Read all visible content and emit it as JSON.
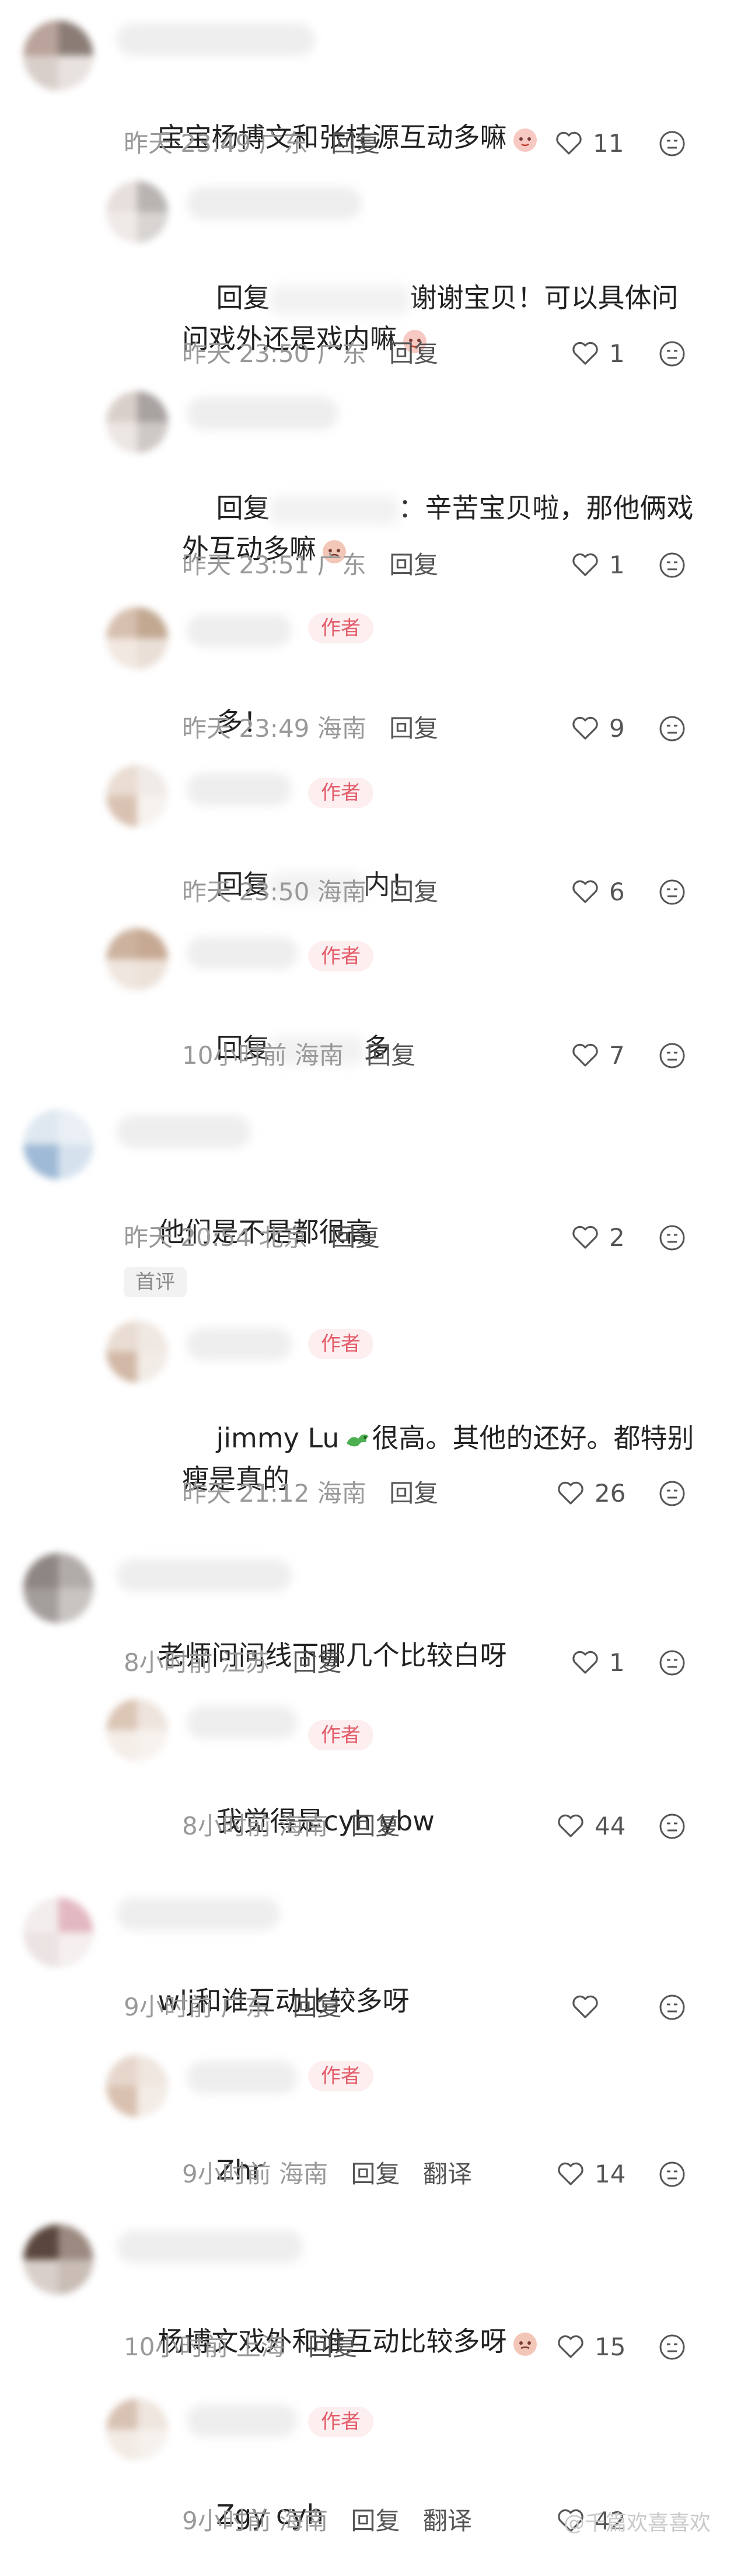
{
  "colors": {
    "author_tag_bg": "#fdeef0",
    "author_tag_text": "#e35d6a",
    "meta": "#999999",
    "text": "#222222"
  },
  "comments": [
    {
      "text": "宝宝杨博文和张桂源互动多嘛",
      "time": "昨天 23:49",
      "location": "广东",
      "reply": "回复",
      "likes": "11"
    },
    {
      "prefix": "回复",
      "text": "谢谢宝贝！可以具体问\n问戏外还是戏内嘛",
      "time": "昨天 23:50",
      "location": "广东",
      "reply": "回复",
      "likes": "1"
    },
    {
      "prefix": "回复",
      "text": "：辛苦宝贝啦，那他俩戏\n外互动多嘛",
      "time": "昨天 23:51",
      "location": "广东",
      "reply": "回复",
      "likes": "1"
    },
    {
      "tag": "作者",
      "text": "多！",
      "time": "昨天 23:49",
      "location": "海南",
      "reply": "回复",
      "likes": "9"
    },
    {
      "tag": "作者",
      "prefix": "回复",
      "text": "内！",
      "time": "昨天 23:50",
      "location": "海南",
      "reply": "回复",
      "likes": "6"
    },
    {
      "tag": "作者",
      "prefix": "回复",
      "text": "多",
      "time": "10小时前",
      "location": "海南",
      "reply": "回复",
      "likes": "7"
    },
    {
      "text": "他们是不是都很高",
      "time": "昨天 20:54",
      "location": "北京",
      "reply": "回复",
      "likes": "2",
      "badge": "首评"
    },
    {
      "tag": "作者",
      "text": "jimmy Lu",
      "text2": "很高。其他的还好。都特别\n瘦是真的",
      "time": "昨天 21:12",
      "location": "海南",
      "reply": "回复",
      "likes": "26"
    },
    {
      "text": "老师问问线下哪几个比较白呀",
      "time": "8小时前",
      "location": "江苏",
      "reply": "回复",
      "likes": "1"
    },
    {
      "tag": "作者",
      "text": "我觉得是cyh ybw",
      "time": "8小时前",
      "location": "海南",
      "reply": "回复",
      "likes": "44"
    },
    {
      "text": "wlj和谁互动比较多呀",
      "time": "9小时前",
      "location": "广东",
      "reply": "回复",
      "likes": ""
    },
    {
      "tag": "作者",
      "text": "Zhr",
      "time": "9小时前",
      "location": "海南",
      "reply": "回复",
      "translate": "翻译",
      "likes": "14"
    },
    {
      "text": "杨博文戏外和谁互动比较多呀",
      "time": "10小时前",
      "location": "上海",
      "reply": "回复",
      "likes": "15"
    },
    {
      "tag": "作者",
      "text": "Zgy cyh",
      "time": "9小时前",
      "location": "海南",
      "reply": "回复",
      "translate": "翻译",
      "likes": "42"
    }
  ],
  "watermark": "@千篇欢喜喜欢"
}
